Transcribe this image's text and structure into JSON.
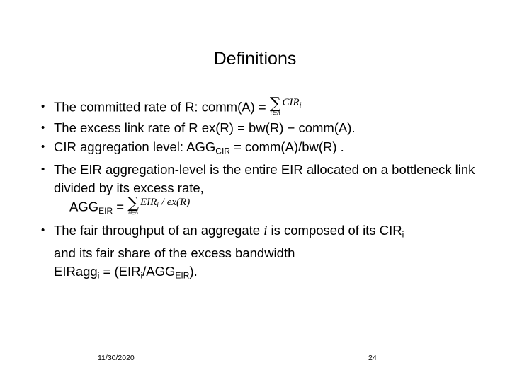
{
  "slide": {
    "title": "Definitions",
    "bullets": [
      {
        "marker": "•",
        "text_before": "The committed rate of R: comm(A) = ",
        "equation": {
          "sigma": "∑",
          "limit": "i∈A",
          "body": "CIR",
          "body_sub": "i"
        }
      },
      {
        "marker": "•",
        "text_before": "The excess link rate of R ex(R) = bw(R) − comm(A).",
        "equation": null
      },
      {
        "marker": "•",
        "text_before": "CIR aggregation level: AGG",
        "sub": "CIR",
        "text_after": " = comm(A)/bw(R) .",
        "equation": null
      },
      {
        "marker": "•",
        "text_before": "The EIR aggregation-level is the entire EIR allocated on a bottleneck link divided by its excess rate,",
        "equation": null
      }
    ],
    "agg_eir_line": {
      "label": "AGG",
      "label_sub": "EIR",
      "equals": " = ",
      "equation": {
        "sigma": "∑",
        "limit": "i∈A",
        "body": "EIR",
        "body_sub": "i",
        "body_rest": " / ex(R)"
      }
    },
    "last_bullet": {
      "marker": "•",
      "line1_a": "The fair throughput of an aggregate ",
      "line1_italic": "i",
      "line1_b": " is composed of its CIR",
      "line1_sub": "i",
      "line2": "and its fair share of the excess bandwidth",
      "line3_a": "EIRagg",
      "line3_sub1": "i",
      "line3_b": " = (EIR",
      "line3_sub2": "i",
      "line3_c": "/AGG",
      "line3_sub3": "EIR",
      "line3_d": ")."
    },
    "footer": {
      "date": "11/30/2020",
      "page_number": "24"
    }
  }
}
